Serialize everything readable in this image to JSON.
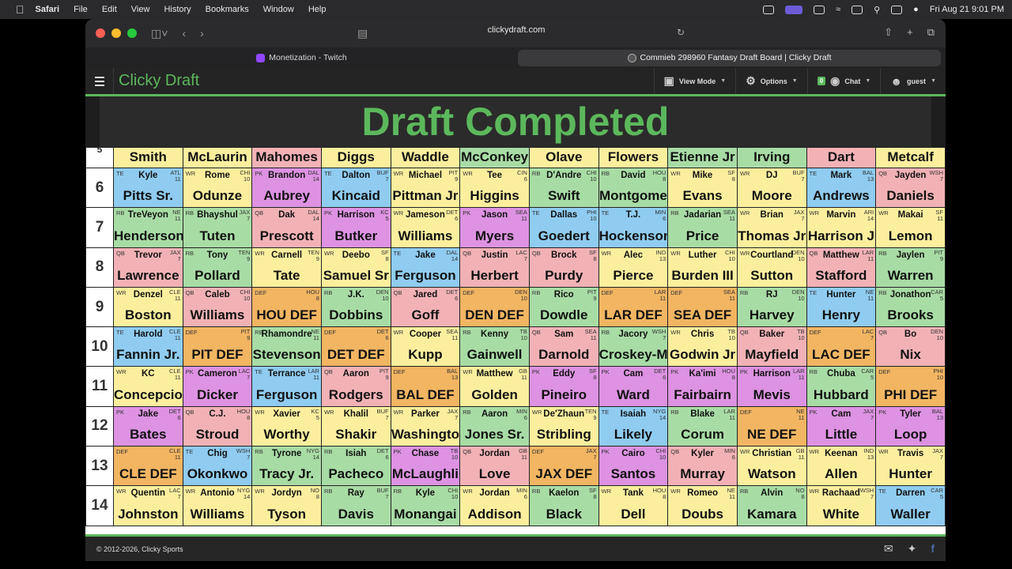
{
  "menubar": {
    "app_name": "Safari",
    "items": [
      "File",
      "Edit",
      "View",
      "History",
      "Bookmarks",
      "Window",
      "Help"
    ],
    "datetime": "Fri Aug 21  9:01 PM"
  },
  "browser": {
    "url": "clickydraft.com",
    "tabs": [
      {
        "label": "Monetization - Twitch",
        "active": false
      },
      {
        "label": "Commieb 298960 Fantasy Draft Board | Clicky Draft",
        "active": true
      }
    ]
  },
  "appnav": {
    "brand": "Clicky Draft",
    "view_mode": "View Mode",
    "options": "Options",
    "chat_count": "0",
    "chat": "Chat",
    "user": "guest"
  },
  "banner": {
    "title": "Draft Completed"
  },
  "colors": {
    "RB": "#a8dca5",
    "WR": "#fbef9e",
    "QB": "#f2b2b5",
    "TE": "#8fccf0",
    "PK": "#dd92e2",
    "DEF": "#f2b562",
    "brand": "#5cb85c"
  },
  "board": {
    "partial_row": {
      "num": "5",
      "picks": [
        {
          "pos": "WR",
          "last": "Smith"
        },
        {
          "pos": "WR",
          "last": "McLaurin"
        },
        {
          "pos": "QB",
          "last": "Mahomes"
        },
        {
          "pos": "WR",
          "last": "Diggs"
        },
        {
          "pos": "WR",
          "last": "Waddle"
        },
        {
          "pos": "RB",
          "last": "McConkey"
        },
        {
          "pos": "WR",
          "last": "Olave"
        },
        {
          "pos": "WR",
          "last": "Flowers"
        },
        {
          "pos": "RB",
          "last": "Etienne Jr"
        },
        {
          "pos": "RB",
          "last": "Irving"
        },
        {
          "pos": "QB",
          "last": "Dart"
        },
        {
          "pos": "WR",
          "last": "Metcalf"
        }
      ]
    },
    "rows": [
      {
        "num": "6",
        "picks": [
          {
            "pos": "TE",
            "first": "Kyle",
            "team": "ATL",
            "num": "11",
            "last": "Pitts Sr."
          },
          {
            "pos": "WR",
            "first": "Rome",
            "team": "CHI",
            "num": "10",
            "last": "Odunze"
          },
          {
            "pos": "PK",
            "first": "Brandon",
            "team": "DAL",
            "num": "14",
            "last": "Aubrey"
          },
          {
            "pos": "TE",
            "first": "Dalton",
            "team": "BUF",
            "num": "7",
            "last": "Kincaid"
          },
          {
            "pos": "WR",
            "first": "Michael",
            "team": "PIT",
            "num": "9",
            "last": "Pittman Jr"
          },
          {
            "pos": "WR",
            "first": "Tee",
            "team": "CIN",
            "num": "6",
            "last": "Higgins"
          },
          {
            "pos": "RB",
            "first": "D'Andre",
            "team": "CHI",
            "num": "10",
            "last": "Swift"
          },
          {
            "pos": "RB",
            "first": "David",
            "team": "HOU",
            "num": "8",
            "last": "Montgome"
          },
          {
            "pos": "WR",
            "first": "Mike",
            "team": "SF",
            "num": "8",
            "last": "Evans"
          },
          {
            "pos": "WR",
            "first": "DJ",
            "team": "BUF",
            "num": "7",
            "last": "Moore"
          },
          {
            "pos": "TE",
            "first": "Mark",
            "team": "BAL",
            "num": "13",
            "last": "Andrews"
          },
          {
            "pos": "QB",
            "first": "Jayden",
            "team": "WSH",
            "num": "7",
            "last": "Daniels"
          }
        ]
      },
      {
        "num": "7",
        "picks": [
          {
            "pos": "RB",
            "first": "TreVeyon",
            "team": "NE",
            "num": "11",
            "last": "Henderson"
          },
          {
            "pos": "RB",
            "first": "Bhayshul",
            "team": "JAX",
            "num": "7",
            "last": "Tuten"
          },
          {
            "pos": "QB",
            "first": "Dak",
            "team": "DAL",
            "num": "14",
            "last": "Prescott"
          },
          {
            "pos": "PK",
            "first": "Harrison",
            "team": "KC",
            "num": "5",
            "last": "Butker"
          },
          {
            "pos": "WR",
            "first": "Jameson",
            "team": "DET",
            "num": "6",
            "last": "Williams"
          },
          {
            "pos": "PK",
            "first": "Jason",
            "team": "SEA",
            "num": "11",
            "last": "Myers"
          },
          {
            "pos": "TE",
            "first": "Dallas",
            "team": "PHI",
            "num": "10",
            "last": "Goedert"
          },
          {
            "pos": "TE",
            "first": "T.J.",
            "team": "MIN",
            "num": "6",
            "last": "Hockenson"
          },
          {
            "pos": "RB",
            "first": "Jadarian",
            "team": "SEA",
            "num": "11",
            "last": "Price"
          },
          {
            "pos": "WR",
            "first": "Brian",
            "team": "JAX",
            "num": "7",
            "last": "Thomas Jr"
          },
          {
            "pos": "WR",
            "first": "Marvin",
            "team": "ARI",
            "num": "14",
            "last": "Harrison J"
          },
          {
            "pos": "WR",
            "first": "Makai",
            "team": "SF",
            "num": "11",
            "last": "Lemon"
          }
        ]
      },
      {
        "num": "8",
        "picks": [
          {
            "pos": "QB",
            "first": "Trevor",
            "team": "JAX",
            "num": "7",
            "last": "Lawrence"
          },
          {
            "pos": "RB",
            "first": "Tony",
            "team": "TEN",
            "num": "9",
            "last": "Pollard"
          },
          {
            "pos": "WR",
            "first": "Carnell",
            "team": "TEN",
            "num": "9",
            "last": "Tate"
          },
          {
            "pos": "WR",
            "first": "Deebo",
            "team": "SF",
            "num": "8",
            "last": "Samuel Sr"
          },
          {
            "pos": "TE",
            "first": "Jake",
            "team": "DAL",
            "num": "14",
            "last": "Ferguson"
          },
          {
            "pos": "QB",
            "first": "Justin",
            "team": "LAC",
            "num": "7",
            "last": "Herbert"
          },
          {
            "pos": "QB",
            "first": "Brock",
            "team": "SF",
            "num": "8",
            "last": "Purdy"
          },
          {
            "pos": "WR",
            "first": "Alec",
            "team": "IND",
            "num": "13",
            "last": "Pierce"
          },
          {
            "pos": "WR",
            "first": "Luther",
            "team": "CHI",
            "num": "10",
            "last": "Burden III"
          },
          {
            "pos": "WR",
            "first": "Courtland",
            "team": "DEN",
            "num": "10",
            "last": "Sutton"
          },
          {
            "pos": "QB",
            "first": "Matthew",
            "team": "LAR",
            "num": "11",
            "last": "Stafford"
          },
          {
            "pos": "RB",
            "first": "Jaylen",
            "team": "PIT",
            "num": "9",
            "last": "Warren"
          }
        ]
      },
      {
        "num": "9",
        "picks": [
          {
            "pos": "WR",
            "first": "Denzel",
            "team": "CLE",
            "num": "11",
            "last": "Boston"
          },
          {
            "pos": "QB",
            "first": "Caleb",
            "team": "CHI",
            "num": "10",
            "last": "Williams"
          },
          {
            "pos": "DEF",
            "first": "",
            "team": "HOU",
            "num": "8",
            "last": "HOU DEF"
          },
          {
            "pos": "RB",
            "first": "J.K.",
            "team": "DEN",
            "num": "10",
            "last": "Dobbins"
          },
          {
            "pos": "QB",
            "first": "Jared",
            "team": "DET",
            "num": "6",
            "last": "Goff"
          },
          {
            "pos": "DEF",
            "first": "",
            "team": "DEN",
            "num": "10",
            "last": "DEN DEF"
          },
          {
            "pos": "RB",
            "first": "Rico",
            "team": "PIT",
            "num": "9",
            "last": "Dowdle"
          },
          {
            "pos": "DEF",
            "first": "",
            "team": "LAR",
            "num": "11",
            "last": "LAR DEF"
          },
          {
            "pos": "DEF",
            "first": "",
            "team": "SEA",
            "num": "11",
            "last": "SEA DEF"
          },
          {
            "pos": "RB",
            "first": "RJ",
            "team": "DEN",
            "num": "10",
            "last": "Harvey"
          },
          {
            "pos": "TE",
            "first": "Hunter",
            "team": "NE",
            "num": "11",
            "last": "Henry"
          },
          {
            "pos": "RB",
            "first": "Jonathon",
            "team": "CAR",
            "num": "5",
            "last": "Brooks"
          }
        ]
      },
      {
        "num": "10",
        "picks": [
          {
            "pos": "TE",
            "first": "Harold",
            "team": "CLE",
            "num": "11",
            "last": "Fannin Jr."
          },
          {
            "pos": "DEF",
            "first": "",
            "team": "PIT",
            "num": "9",
            "last": "PIT DEF"
          },
          {
            "pos": "RB",
            "first": "Rhamondre",
            "team": "NE",
            "num": "11",
            "last": "Stevenson"
          },
          {
            "pos": "DEF",
            "first": "",
            "team": "DET",
            "num": "6",
            "last": "DET DEF"
          },
          {
            "pos": "WR",
            "first": "Cooper",
            "team": "SEA",
            "num": "11",
            "last": "Kupp"
          },
          {
            "pos": "RB",
            "first": "Kenny",
            "team": "TB",
            "num": "10",
            "last": "Gainwell"
          },
          {
            "pos": "QB",
            "first": "Sam",
            "team": "SEA",
            "num": "11",
            "last": "Darnold"
          },
          {
            "pos": "RB",
            "first": "Jacory",
            "team": "WSH",
            "num": "7",
            "last": "Croskey-M"
          },
          {
            "pos": "WR",
            "first": "Chris",
            "team": "TB",
            "num": "10",
            "last": "Godwin Jr"
          },
          {
            "pos": "QB",
            "first": "Baker",
            "team": "TB",
            "num": "10",
            "last": "Mayfield"
          },
          {
            "pos": "DEF",
            "first": "",
            "team": "LAC",
            "num": "7",
            "last": "LAC DEF"
          },
          {
            "pos": "QB",
            "first": "Bo",
            "team": "DEN",
            "num": "10",
            "last": "Nix"
          }
        ]
      },
      {
        "num": "11",
        "picks": [
          {
            "pos": "WR",
            "first": "KC",
            "team": "CLE",
            "num": "11",
            "last": "Concepcio"
          },
          {
            "pos": "PK",
            "first": "Cameron",
            "team": "LAC",
            "num": "7",
            "last": "Dicker"
          },
          {
            "pos": "TE",
            "first": "Terrance",
            "team": "LAR",
            "num": "11",
            "last": "Ferguson"
          },
          {
            "pos": "QB",
            "first": "Aaron",
            "team": "PIT",
            "num": "9",
            "last": "Rodgers"
          },
          {
            "pos": "DEF",
            "first": "",
            "team": "BAL",
            "num": "13",
            "last": "BAL DEF"
          },
          {
            "pos": "WR",
            "first": "Matthew",
            "team": "GB",
            "num": "11",
            "last": "Golden"
          },
          {
            "pos": "PK",
            "first": "Eddy",
            "team": "SF",
            "num": "8",
            "last": "Pineiro"
          },
          {
            "pos": "PK",
            "first": "Cam",
            "team": "DET",
            "num": "6",
            "last": "Ward"
          },
          {
            "pos": "PK",
            "first": "Ka'imi",
            "team": "HOU",
            "num": "8",
            "last": "Fairbairn"
          },
          {
            "pos": "PK",
            "first": "Harrison",
            "team": "LAR",
            "num": "11",
            "last": "Mevis"
          },
          {
            "pos": "RB",
            "first": "Chuba",
            "team": "CAR",
            "num": "5",
            "last": "Hubbard"
          },
          {
            "pos": "DEF",
            "first": "",
            "team": "PHI",
            "num": "10",
            "last": "PHI DEF"
          }
        ]
      },
      {
        "num": "12",
        "picks": [
          {
            "pos": "PK",
            "first": "Jake",
            "team": "DET",
            "num": "6",
            "last": "Bates"
          },
          {
            "pos": "QB",
            "first": "C.J.",
            "team": "HOU",
            "num": "8",
            "last": "Stroud"
          },
          {
            "pos": "WR",
            "first": "Xavier",
            "team": "KC",
            "num": "5",
            "last": "Worthy"
          },
          {
            "pos": "WR",
            "first": "Khalil",
            "team": "BUF",
            "num": "7",
            "last": "Shakir"
          },
          {
            "pos": "WR",
            "first": "Parker",
            "team": "JAX",
            "num": "7",
            "last": "Washingto"
          },
          {
            "pos": "RB",
            "first": "Aaron",
            "team": "MIN",
            "num": "6",
            "last": "Jones Sr."
          },
          {
            "pos": "WR",
            "first": "De'Zhaun",
            "team": "TEN",
            "num": "9",
            "last": "Stribling"
          },
          {
            "pos": "TE",
            "first": "Isaiah",
            "team": "NYG",
            "num": "14",
            "last": "Likely"
          },
          {
            "pos": "RB",
            "first": "Blake",
            "team": "LAR",
            "num": "11",
            "last": "Corum"
          },
          {
            "pos": "DEF",
            "first": "",
            "team": "NE",
            "num": "11",
            "last": "NE DEF"
          },
          {
            "pos": "PK",
            "first": "Cam",
            "team": "JAX",
            "num": "7",
            "last": "Little"
          },
          {
            "pos": "PK",
            "first": "Tyler",
            "team": "BAL",
            "num": "13",
            "last": "Loop"
          }
        ]
      },
      {
        "num": "13",
        "picks": [
          {
            "pos": "DEF",
            "first": "",
            "team": "CLE",
            "num": "11",
            "last": "CLE DEF"
          },
          {
            "pos": "TE",
            "first": "Chig",
            "team": "WSH",
            "num": "7",
            "last": "Okonkwo"
          },
          {
            "pos": "RB",
            "first": "Tyrone",
            "team": "NYG",
            "num": "14",
            "last": "Tracy Jr."
          },
          {
            "pos": "RB",
            "first": "Isiah",
            "team": "DET",
            "num": "6",
            "last": "Pacheco"
          },
          {
            "pos": "PK",
            "first": "Chase",
            "team": "TB",
            "num": "10",
            "last": "McLaughli"
          },
          {
            "pos": "QB",
            "first": "Jordan",
            "team": "GB",
            "num": "11",
            "last": "Love"
          },
          {
            "pos": "DEF",
            "first": "",
            "team": "JAX",
            "num": "7",
            "last": "JAX DEF"
          },
          {
            "pos": "PK",
            "first": "Cairo",
            "team": "CHI",
            "num": "10",
            "last": "Santos"
          },
          {
            "pos": "QB",
            "first": "Kyler",
            "team": "MIN",
            "num": "6",
            "last": "Murray"
          },
          {
            "pos": "WR",
            "first": "Christian",
            "team": "GB",
            "num": "11",
            "last": "Watson"
          },
          {
            "pos": "WR",
            "first": "Keenan",
            "team": "IND",
            "num": "13",
            "last": "Allen"
          },
          {
            "pos": "WR",
            "first": "Travis",
            "team": "JAX",
            "num": "7",
            "last": "Hunter"
          }
        ]
      },
      {
        "num": "14",
        "picks": [
          {
            "pos": "WR",
            "first": "Quentin",
            "team": "LAC",
            "num": "7",
            "last": "Johnston"
          },
          {
            "pos": "WR",
            "first": "Antonio",
            "team": "NYG",
            "num": "14",
            "last": "Williams"
          },
          {
            "pos": "WR",
            "first": "Jordyn",
            "team": "NO",
            "num": "8",
            "last": "Tyson"
          },
          {
            "pos": "RB",
            "first": "Ray",
            "team": "BUF",
            "num": "7",
            "last": "Davis"
          },
          {
            "pos": "RB",
            "first": "Kyle",
            "team": "CHI",
            "num": "10",
            "last": "Monangai"
          },
          {
            "pos": "WR",
            "first": "Jordan",
            "team": "MIN",
            "num": "6",
            "last": "Addison"
          },
          {
            "pos": "RB",
            "first": "Kaelon",
            "team": "SF",
            "num": "8",
            "last": "Black"
          },
          {
            "pos": "WR",
            "first": "Tank",
            "team": "HOU",
            "num": "8",
            "last": "Dell"
          },
          {
            "pos": "WR",
            "first": "Romeo",
            "team": "NE",
            "num": "11",
            "last": "Doubs"
          },
          {
            "pos": "RB",
            "first": "Alvin",
            "team": "NO",
            "num": "8",
            "last": "Kamara"
          },
          {
            "pos": "WR",
            "first": "Rachaad",
            "team": "WSH",
            "num": "7",
            "last": "White"
          },
          {
            "pos": "TE",
            "first": "Darren",
            "team": "CAR",
            "num": "5",
            "last": "Waller"
          }
        ]
      }
    ]
  },
  "footer": {
    "copyright": "© 2012-2026, Clicky Sports"
  }
}
